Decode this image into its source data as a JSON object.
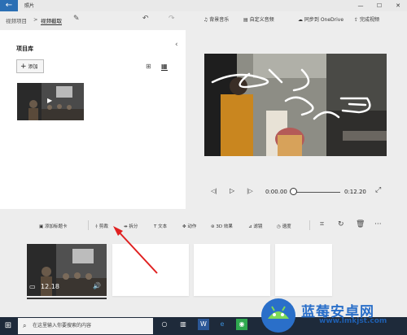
{
  "app": {
    "title": "照片"
  },
  "breadcrumb": {
    "parent": "视频项目",
    "current": "视频截取"
  },
  "toolbar": {
    "music": "背景音乐",
    "custom_audio": "自定义音频",
    "sync": "同步到 OneDrive",
    "finish": "完成视频"
  },
  "library": {
    "title": "项目库",
    "add_label": "添加"
  },
  "player": {
    "time_current": "0:00.00",
    "time_end": "0:12.20"
  },
  "edit_tools": {
    "title_card": "添加标题卡",
    "trim": "剪裁",
    "split": "拆分",
    "text": "文本",
    "motion": "动作",
    "effects": "3D 效果",
    "filters": "滤镜",
    "speed": "速度"
  },
  "storyboard": {
    "clip_duration": "12.18"
  },
  "taskbar": {
    "search_placeholder": "在这里输入你要搜索的内容"
  },
  "watermark": {
    "text": "蓝莓安卓网",
    "url": "www.lmkjst.com"
  },
  "colors": {
    "accent": "#2b6fb4",
    "annotation_arrow": "#e02020",
    "taskbar": "#1e2a3a"
  }
}
